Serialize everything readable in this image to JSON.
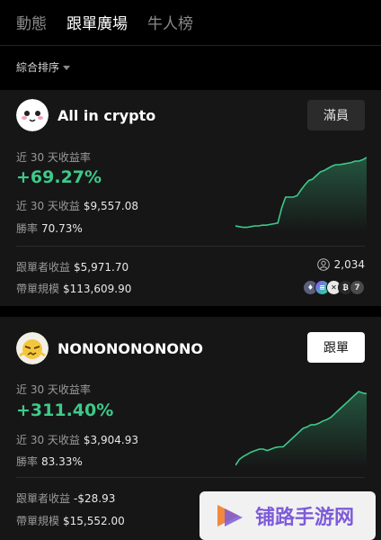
{
  "nav": {
    "tabs": [
      {
        "label": "動態"
      },
      {
        "label": "跟單廣場"
      },
      {
        "label": "牛人榜"
      }
    ]
  },
  "sort": {
    "label": "綜合排序"
  },
  "traders": [
    {
      "name": "All in crypto",
      "button_label": "滿員",
      "return_label": "近 30 天收益率",
      "return_pct": "+69.27%",
      "pnl_label": "近 30 天收益",
      "pnl_value": "$9,557.08",
      "winrate_label": "勝率",
      "winrate_value": "70.73%",
      "follower_pnl_label": "跟單者收益",
      "follower_pnl_value": "$5,971.70",
      "aum_label": "帶單規模",
      "aum_value": "$113,609.90",
      "followers": "2,034",
      "extra_coins": "7",
      "spark": [
        0.05,
        0.04,
        0.03,
        0.03,
        0.04,
        0.05,
        0.05,
        0.06,
        0.06,
        0.07,
        0.08,
        0.09,
        0.3,
        0.45,
        0.45,
        0.45,
        0.47,
        0.55,
        0.62,
        0.68,
        0.7,
        0.75,
        0.8,
        0.82,
        0.85,
        0.88,
        0.9,
        0.9,
        0.91,
        0.92,
        0.93,
        0.95,
        0.95,
        0.97,
        1.0
      ]
    },
    {
      "name": "NONONONONONO",
      "button_label": "跟單",
      "return_label": "近 30 天收益率",
      "return_pct": "+311.40%",
      "pnl_label": "近 30 天收益",
      "pnl_value": "$3,904.93",
      "winrate_label": "勝率",
      "winrate_value": "83.33%",
      "follower_pnl_label": "跟單者收益",
      "follower_pnl_value": "-$28.93",
      "aum_label": "帶單規模",
      "aum_value": "$15,552.00",
      "spark": [
        0.0,
        0.08,
        0.12,
        0.15,
        0.18,
        0.2,
        0.22,
        0.22,
        0.2,
        0.22,
        0.24,
        0.25,
        0.25,
        0.3,
        0.35,
        0.4,
        0.45,
        0.5,
        0.52,
        0.55,
        0.55,
        0.57,
        0.6,
        0.62,
        0.65,
        0.7,
        0.75,
        0.8,
        0.85,
        0.9,
        0.95,
        1.0,
        0.98,
        0.97
      ]
    }
  ],
  "watermark": {
    "text": "铺路手游网"
  },
  "colors": {
    "accent": "#3ec98a",
    "watermark": "#7d5bd9"
  }
}
